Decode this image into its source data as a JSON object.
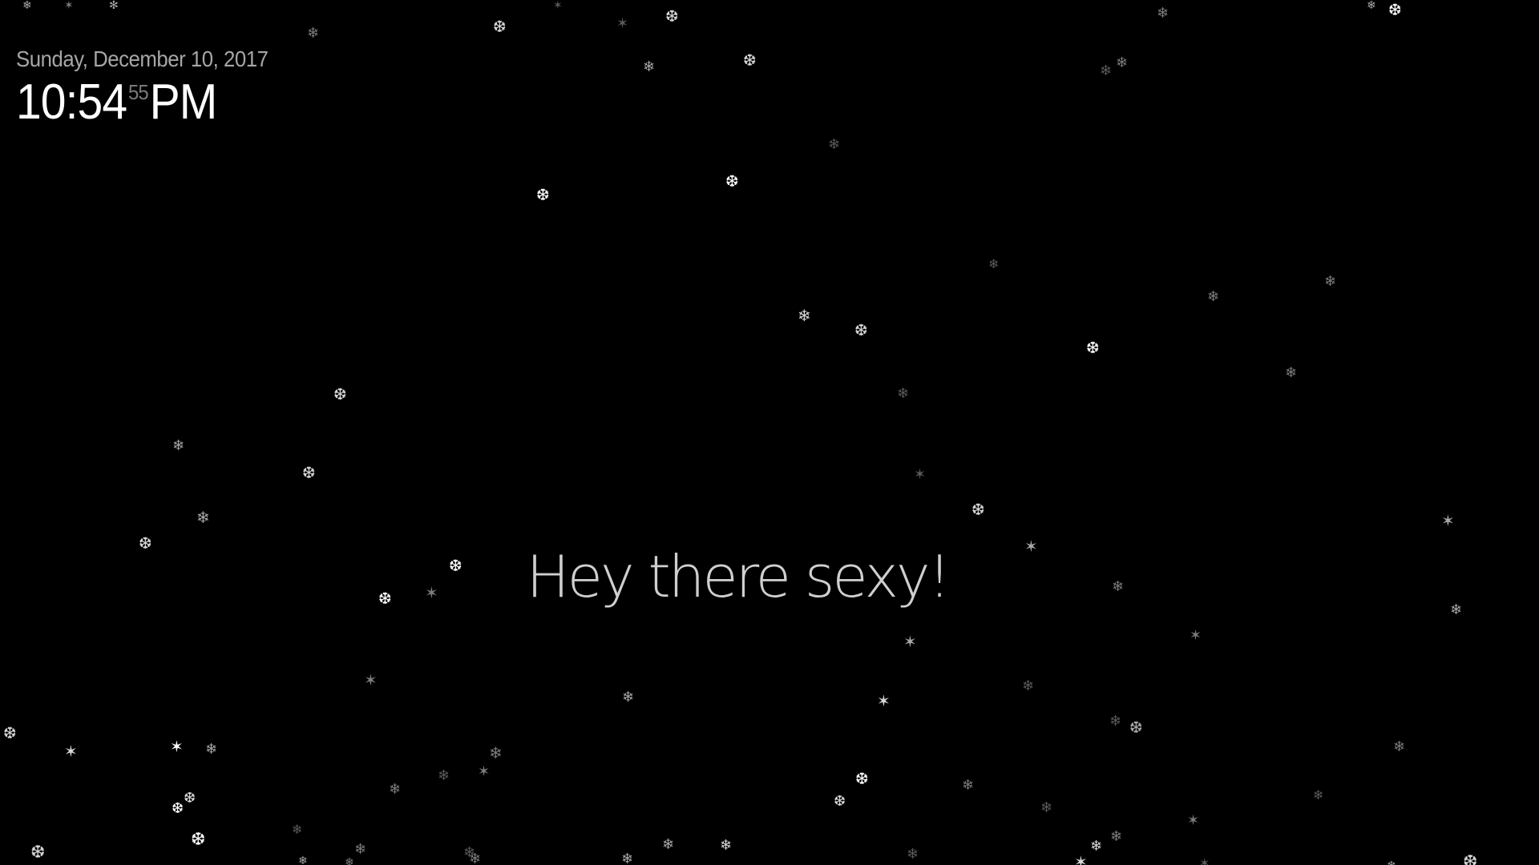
{
  "clock": {
    "date": "Sunday, December 10, 2017",
    "time_hm": "10:54",
    "time_seconds": "55",
    "time_period": "PM"
  },
  "compliment": {
    "text": "Hey there sexy!"
  },
  "snow": {
    "icon": "snowflake-icon",
    "glyphs": [
      "❄",
      "❆",
      "❅",
      "✻",
      "✶"
    ],
    "colors": [
      "#ffffff",
      "#d8d8d8",
      "#a8a8a8",
      "#7c7c7c",
      "#5a5a5a"
    ]
  },
  "theme": {
    "background": "#000000",
    "text_primary": "#ffffff",
    "text_secondary": "#a6a6a6"
  }
}
